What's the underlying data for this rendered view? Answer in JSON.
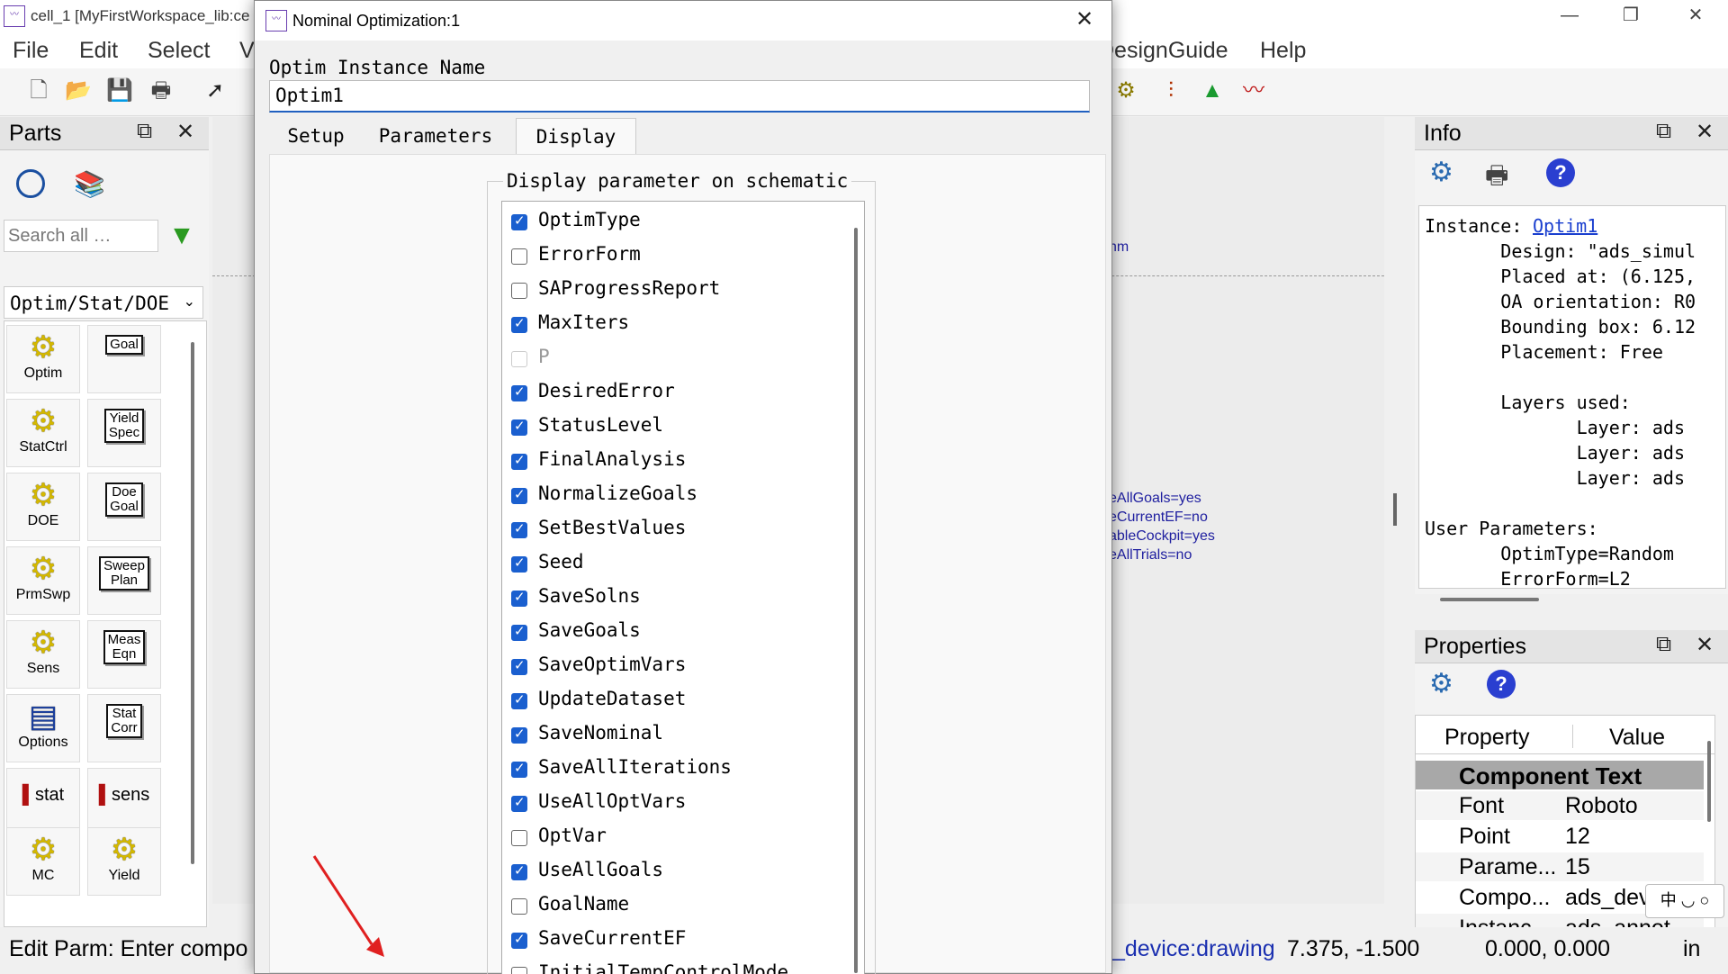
{
  "app": {
    "title": "cell_1 [MyFirstWorkspace_lib:ce",
    "menus": [
      "File",
      "Edit",
      "Select",
      "V",
      "DesignGuide",
      "Help"
    ],
    "window_controls": [
      "—",
      "❐",
      "✕"
    ]
  },
  "parts": {
    "title": "Parts",
    "search_placeholder": "Search all …",
    "library": "Optim/Stat/DOE",
    "items": [
      {
        "label": "Optim",
        "kind": "gear"
      },
      {
        "label": "Goal",
        "kind": "box"
      },
      {
        "label": "StatCtrl",
        "kind": "gear"
      },
      {
        "label": "Yield\nSpec",
        "kind": "box"
      },
      {
        "label": "DOE",
        "kind": "gear"
      },
      {
        "label": "Doe\nGoal",
        "kind": "box"
      },
      {
        "label": "PrmSwp",
        "kind": "gear"
      },
      {
        "label": "Sweep\nPlan",
        "kind": "box"
      },
      {
        "label": "Sens",
        "kind": "gear"
      },
      {
        "label": "Meas\nEqn",
        "kind": "box"
      },
      {
        "label": "Options",
        "kind": "options"
      },
      {
        "label": "Stat\nCorr",
        "kind": "box"
      },
      {
        "label": "stat",
        "kind": "chart"
      },
      {
        "label": "sens",
        "kind": "chart"
      },
      {
        "label": "MC",
        "kind": "gear"
      },
      {
        "label": "Yield",
        "kind": "gear"
      }
    ]
  },
  "canvas": {
    "fragments": [
      "hm",
      "eAllGoals=yes",
      "eCurrentEF=no",
      "ableCockpit=yes",
      "eAllTrials=no"
    ]
  },
  "info": {
    "title": "Info",
    "instance_label": "Instance:",
    "instance_link": "Optim1",
    "lines": [
      "       Design: \"ads_simul",
      "       Placed at: (6.125,",
      "       OA orientation: R0",
      "       Bounding box: 6.12",
      "       Placement: Free",
      "",
      "       Layers used:",
      "              Layer: ads",
      "              Layer: ads",
      "              Layer: ads",
      "",
      "User Parameters:",
      "       OptimType=Random",
      "       ErrorForm=L2"
    ]
  },
  "properties": {
    "title": "Properties",
    "col_property": "Property",
    "col_value": "Value",
    "section": "Component Text",
    "rows": [
      {
        "name": "Font",
        "value": "Roboto"
      },
      {
        "name": "Point",
        "value": "12"
      },
      {
        "name": "Parame...",
        "value": "15"
      },
      {
        "name": "Compo...",
        "value": "ads_dev"
      },
      {
        "name": "Instanc",
        "value": "ads_annot"
      }
    ],
    "ime_indicator": "中 ◡ ○"
  },
  "status": {
    "message": "Edit Parm: Enter compo",
    "context": "_device:drawing",
    "coords": "7.375, -1.500",
    "delta": "0.000, 0.000",
    "units": "in"
  },
  "dialog": {
    "title": "Nominal Optimization:1",
    "instance_name_label": "Optim Instance Name",
    "instance_name_value": "Optim1",
    "tabs": [
      "Setup",
      "Parameters",
      "Display"
    ],
    "active_tab": "Display",
    "group_title": "Display parameter on schematic",
    "params": [
      {
        "name": "OptimType",
        "state": "checked"
      },
      {
        "name": "ErrorForm",
        "state": "unchecked"
      },
      {
        "name": "SAProgressReport",
        "state": "unchecked"
      },
      {
        "name": "MaxIters",
        "state": "checked"
      },
      {
        "name": "P",
        "state": "disabled"
      },
      {
        "name": "DesiredError",
        "state": "checked"
      },
      {
        "name": "StatusLevel",
        "state": "checked"
      },
      {
        "name": "FinalAnalysis",
        "state": "checked"
      },
      {
        "name": "NormalizeGoals",
        "state": "checked"
      },
      {
        "name": "SetBestValues",
        "state": "checked"
      },
      {
        "name": "Seed",
        "state": "checked"
      },
      {
        "name": "SaveSolns",
        "state": "checked"
      },
      {
        "name": "SaveGoals",
        "state": "checked"
      },
      {
        "name": "SaveOptimVars",
        "state": "checked"
      },
      {
        "name": "UpdateDataset",
        "state": "checked"
      },
      {
        "name": "SaveNominal",
        "state": "checked"
      },
      {
        "name": "SaveAllIterations",
        "state": "checked"
      },
      {
        "name": "UseAllOptVars",
        "state": "checked"
      },
      {
        "name": "OptVar",
        "state": "unchecked"
      },
      {
        "name": "UseAllGoals",
        "state": "checked"
      },
      {
        "name": "GoalName",
        "state": "unchecked"
      },
      {
        "name": "SaveCurrentEF",
        "state": "checked"
      },
      {
        "name": "InitialTempControlMode",
        "state": "unchecked"
      }
    ]
  },
  "colors": {
    "accent": "#1a5fcf",
    "link": "#1a3fcf",
    "arrow": "#e02020"
  }
}
